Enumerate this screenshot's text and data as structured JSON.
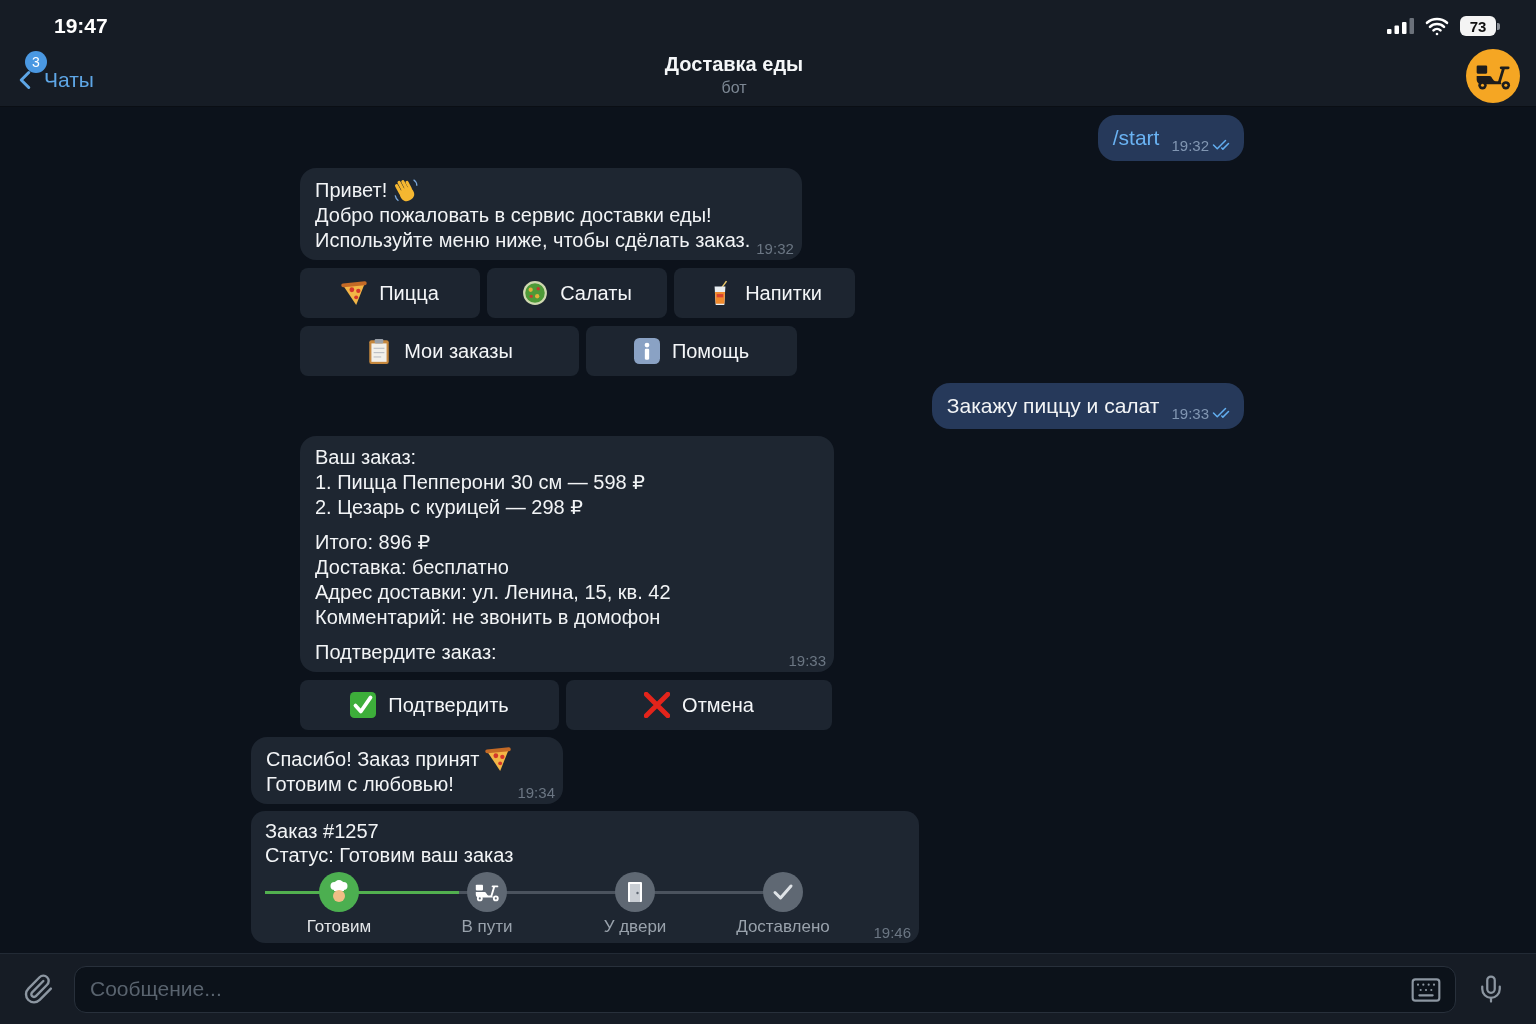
{
  "status_bar": {
    "time": "19:47",
    "battery": "73"
  },
  "header": {
    "back_label": "Чаты",
    "unread_badge": "3",
    "title": "Доставка еды",
    "subtitle": "бот"
  },
  "messages": [
    {
      "kind": "outgoing",
      "text": "/start",
      "command": true,
      "time": "19:32",
      "read": true
    },
    {
      "kind": "welcome",
      "paragraphs": [
        [
          "Привет!",
          "Добро пожаловать в сервис доставки еды!",
          "Используйте меню ниже, чтобы сдёлать заказ."
        ]
      ],
      "time": "19:32",
      "keyboard": [
        [
          {
            "kind": "pizza",
            "label": "Пицца"
          },
          {
            "kind": "salad",
            "label": "Салаты"
          },
          {
            "kind": "drink",
            "label": "Напитки"
          }
        ],
        [
          {
            "kind": "orders",
            "label": "Мои заказы"
          },
          {
            "kind": "help",
            "label": "Помощь"
          }
        ]
      ]
    },
    {
      "kind": "outgoing",
      "text": "Закажу пиццу и салат",
      "command": false,
      "time": "19:33",
      "read": true
    },
    {
      "kind": "order",
      "paragraphs": [
        [
          "Ваш заказ:",
          "1. Пицца Пепперони 30 см — 598 ₽",
          "2. Цезарь с курицей — 298 ₽"
        ],
        [
          "Итого: 896 ₽",
          "Доставка: бесплатно",
          "Адрес доставки: ул. Ленина, 15, кв. 42",
          "Комментарий: не звонить в домофон"
        ],
        [
          "Подтвердите заказ:"
        ]
      ],
      "time": "19:33",
      "keyboard": [
        [
          {
            "kind": "confirm",
            "label": "Подтвердить"
          },
          {
            "kind": "cancel",
            "label": "Отмена"
          }
        ]
      ]
    },
    {
      "kind": "thanks",
      "paragraphs": [
        [
          "Спасибо! Заказ принят",
          "Готовим с любовью!"
        ]
      ],
      "time": "19:34"
    },
    {
      "kind": "tracking",
      "title": "Заказ #1257",
      "status": "Статус: Готовим ваш заказ",
      "progress": {
        "level": 0.36,
        "steps": [
          {
            "kind": "cooking",
            "label": "Готовим",
            "active": true
          },
          {
            "kind": "delivery",
            "label": "В пути",
            "active": false
          },
          {
            "kind": "door",
            "label": "У двери",
            "active": false
          },
          {
            "kind": "delivered",
            "label": "Доставлено",
            "active": false
          }
        ]
      },
      "time": "19:46"
    }
  ],
  "composer": {
    "placeholder": "Сообщение..."
  }
}
